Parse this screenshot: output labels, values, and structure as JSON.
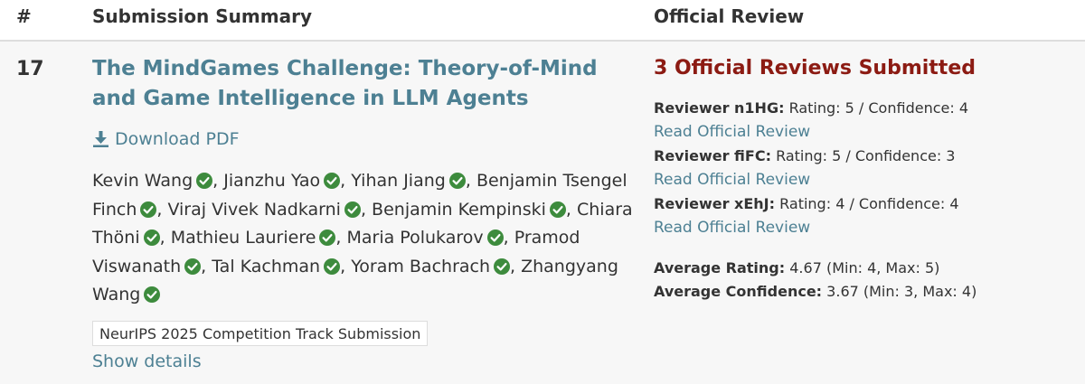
{
  "table_header": {
    "num_label": "#",
    "summary_label": "Submission Summary",
    "review_label": "Official Review"
  },
  "submission": {
    "number": "17",
    "title": "The MindGames Challenge: Theory-of-Mind and Game Intelligence in LLM Agents",
    "download_label": "Download PDF",
    "authors": [
      {
        "name": "Kevin Wang",
        "verified": true
      },
      {
        "name": "Jianzhu Yao",
        "verified": true
      },
      {
        "name": "Yihan Jiang",
        "verified": true
      },
      {
        "name": "Benjamin Tsengel Finch",
        "verified": true
      },
      {
        "name": "Viraj Vivek Nadkarni",
        "verified": true
      },
      {
        "name": "Benjamin Kempinski",
        "verified": true
      },
      {
        "name": "Chiara Thöni",
        "verified": true
      },
      {
        "name": "Mathieu Lauriere",
        "verified": true
      },
      {
        "name": "Maria Polukarov",
        "verified": true
      },
      {
        "name": "Pramod Viswanath",
        "verified": true
      },
      {
        "name": "Tal Kachman",
        "verified": true
      },
      {
        "name": "Yoram Bachrach",
        "verified": true
      },
      {
        "name": "Zhangyang Wang",
        "verified": true
      }
    ],
    "venue": "NeurIPS 2025 Competition Track Submission",
    "show_details_label": "Show details"
  },
  "review": {
    "title": "3 Official Reviews Submitted",
    "reviewers": [
      {
        "label": "Reviewer n1HG:",
        "stats": "Rating: 5 / Confidence: 4",
        "link": "Read Official Review"
      },
      {
        "label": "Reviewer fiFC:",
        "stats": "Rating: 5 / Confidence: 3",
        "link": "Read Official Review"
      },
      {
        "label": "Reviewer xEhJ:",
        "stats": "Rating: 4 / Confidence: 4",
        "link": "Read Official Review"
      }
    ],
    "average_rating_label": "Average Rating:",
    "average_rating_value": "4.67 (Min: 4, Max: 5)",
    "average_confidence_label": "Average Confidence:",
    "average_confidence_value": "3.67 (Min: 3, Max: 4)"
  },
  "colors": {
    "link": "#4d8093",
    "review_title": "#8c1b13",
    "verified_check": "#3d8b3d"
  },
  "icons": {
    "download": "download-icon",
    "verified": "verified-check-icon"
  }
}
